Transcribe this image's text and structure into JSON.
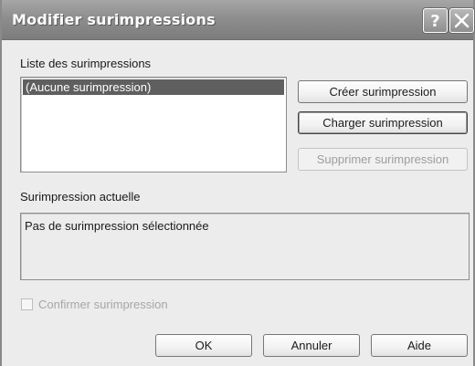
{
  "dialog": {
    "title": "Modifier surimpressions",
    "help_glyph": "?",
    "close_glyph": "✕"
  },
  "list_section": {
    "label": "Liste des surimpressions",
    "items": [
      "(Aucune surimpression)"
    ],
    "selected_index": 0
  },
  "side_buttons": {
    "create": "Créer surimpression",
    "load": "Charger surimpression",
    "delete": "Supprimer surimpression"
  },
  "current_section": {
    "label": "Surimpression actuelle",
    "value": "Pas de surimpression sélectionnée"
  },
  "confirm_checkbox": {
    "label": "Confirmer surimpression",
    "checked": false,
    "enabled": false
  },
  "footer": {
    "ok": "OK",
    "cancel": "Annuler",
    "help": "Aide"
  },
  "colors": {
    "titlebar": "#8e8e8e",
    "selection": "#5f5f5f",
    "disabled_text": "#9d9d9d"
  },
  "icons": {
    "help": "question-mark-icon",
    "close": "close-x-icon"
  }
}
